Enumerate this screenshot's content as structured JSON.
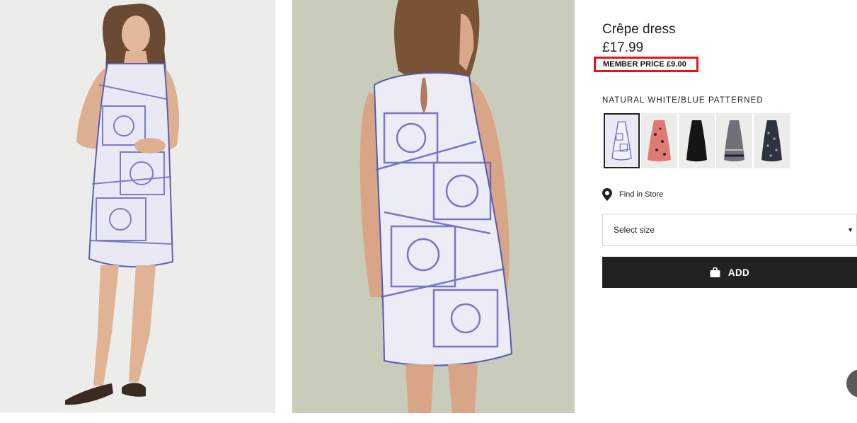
{
  "gallery": {
    "images": [
      {
        "icon": "model-front-photo",
        "description_hidden": true
      },
      {
        "icon": "model-back-photo",
        "description_hidden": true
      }
    ]
  },
  "product": {
    "title": "Crêpe dress",
    "price": "£17.99",
    "member_price": "MEMBER PRICE £9.00",
    "color_name": "NATURAL WHITE/BLUE PATTERNED"
  },
  "swatches": [
    {
      "icon": "dress-swatch-blue-patterned",
      "selected": true,
      "color": "#7a7fc8"
    },
    {
      "icon": "dress-swatch-pink-patterned",
      "selected": false,
      "color": "#e07a74"
    },
    {
      "icon": "dress-swatch-black",
      "selected": false,
      "color": "#151515"
    },
    {
      "icon": "dress-swatch-grey-striped",
      "selected": false,
      "color": "#6f7078"
    },
    {
      "icon": "dress-swatch-dark-floral",
      "selected": false,
      "color": "#2d3440"
    }
  ],
  "store": {
    "find_in_store_label": "Find in Store",
    "icon": "map-pin-icon"
  },
  "size_select": {
    "label": "Select size",
    "icon": "caret-down-icon"
  },
  "add_button": {
    "label": "ADD",
    "icon": "shopping-bag-icon",
    "background": "#222222"
  },
  "colors": {
    "highlight": "#e4141b",
    "text": "#222222"
  }
}
